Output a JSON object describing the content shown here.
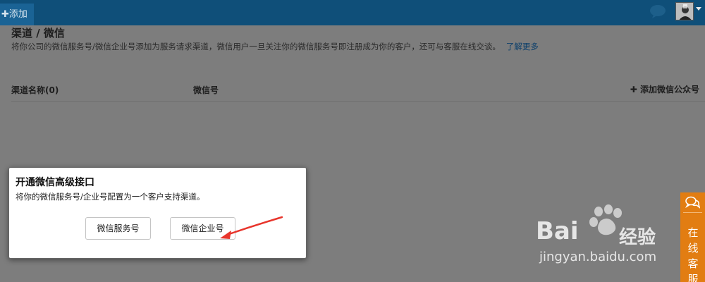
{
  "topbar": {
    "add_label": "✚添加",
    "icons": [
      "chat-bubble-icon",
      "avatar",
      "chevron-down-icon"
    ]
  },
  "page": {
    "title": "渠道 / 微信",
    "description": "将你公司的微信服务号/微信企业号添加为服务请求渠道，微信用户一旦关注你的微信服务号即注册成为你的客户，还可与客服在线交谈。",
    "learn_more": "了解更多"
  },
  "table": {
    "col_name": "渠道名称(0)",
    "col_wechat": "微信号",
    "add_account": "✚ 添加微信公众号"
  },
  "dialog": {
    "title": "开通微信高级接口",
    "description": "将你的微信服务号/企业号配置为一个客户支持渠道。",
    "btn_service": "微信服务号",
    "btn_enterprise": "微信企业号"
  },
  "watermark": {
    "brand": "Bai",
    "brand_tail": "经验",
    "url": "jingyan.baidu.com"
  },
  "online_service": {
    "label": "在线客服"
  },
  "colors": {
    "topbar": "#0f4f79",
    "accent_orange": "#e27d12",
    "annotation_arrow": "#e8352c",
    "overlay_gray": "#7d7d7d"
  }
}
